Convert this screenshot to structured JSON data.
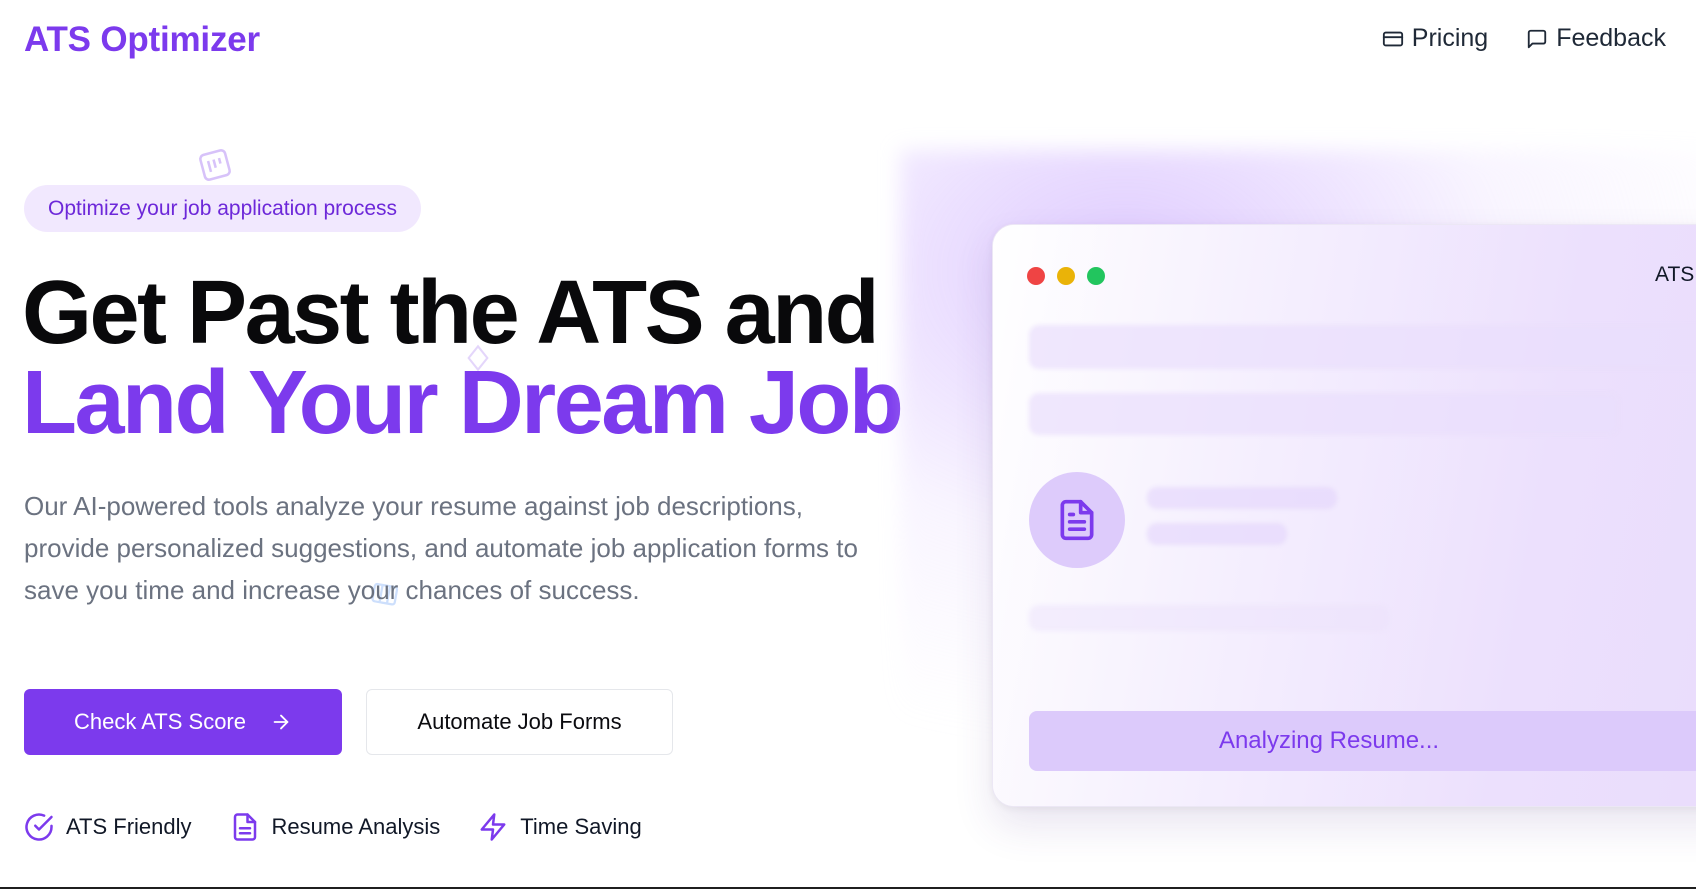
{
  "header": {
    "brand": "ATS Optimizer",
    "nav": [
      {
        "label": "Pricing",
        "icon": "credit-card-icon"
      },
      {
        "label": "Feedback",
        "icon": "message-square-icon"
      }
    ]
  },
  "hero": {
    "badge": "Optimize your job application process",
    "title_line1": "Get Past the ATS and",
    "title_line2": "Land Your Dream Job",
    "description": "Our AI-powered tools analyze your resume against job descriptions, provide personalized suggestions, and automate job application forms to save you time and increase your chances of success.",
    "primary_button": "Check ATS Score",
    "secondary_button": "Automate Job Forms",
    "features": [
      {
        "label": "ATS Friendly",
        "icon": "check-circle-icon"
      },
      {
        "label": "Resume Analysis",
        "icon": "file-text-icon"
      },
      {
        "label": "Time Saving",
        "icon": "zap-icon"
      }
    ]
  },
  "mockup": {
    "title": "ATS",
    "status": "Analyzing Resume..."
  },
  "colors": {
    "accent": "#7c3aed",
    "badge_bg": "#f1e8fe",
    "text_muted": "#6b7280"
  }
}
